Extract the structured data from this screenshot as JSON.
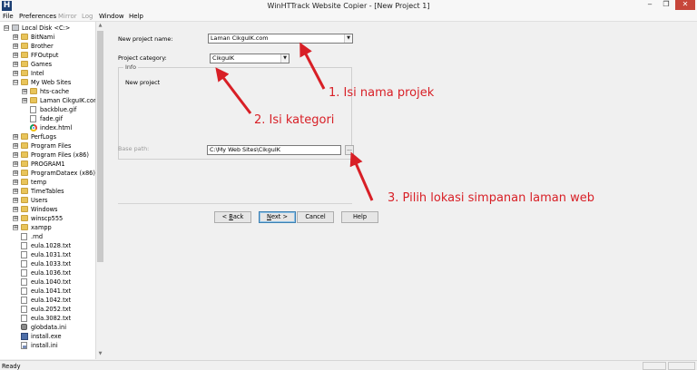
{
  "window": {
    "title": "WinHTTrack Website Copier - [New Project 1]",
    "app_icon_letter": "H",
    "min_glyph": "‒",
    "max_glyph": "❐",
    "close_glyph": "✕"
  },
  "menu": {
    "file": "File",
    "preferences": "Preferences",
    "mirror": "Mirror",
    "log": "Log",
    "window": "Window",
    "help": "Help"
  },
  "tree": {
    "items": [
      {
        "label": "Local Disk <C:>",
        "icon": "drive-icon",
        "expander": "⊟"
      },
      {
        "label": "BitNami",
        "icon": "folder-icon",
        "expander": "⊞"
      },
      {
        "label": "Brother",
        "icon": "folder-icon",
        "expander": "⊞"
      },
      {
        "label": "FFOutput",
        "icon": "folder-icon",
        "expander": "⊞"
      },
      {
        "label": "Games",
        "icon": "folder-icon",
        "expander": "⊞"
      },
      {
        "label": "Intel",
        "icon": "folder-icon",
        "expander": "⊞"
      },
      {
        "label": "My Web Sites",
        "icon": "folder-icon",
        "expander": "⊟"
      },
      {
        "label": "hts-cache",
        "icon": "folder-icon",
        "expander": "⊞"
      },
      {
        "label": "Laman CikguIK.com",
        "icon": "folder-icon",
        "expander": "⊞"
      },
      {
        "label": "backblue.gif",
        "icon": "file-icon",
        "expander": ""
      },
      {
        "label": "fade.gif",
        "icon": "file-icon",
        "expander": ""
      },
      {
        "label": "index.html",
        "icon": "chrome-icon",
        "expander": ""
      },
      {
        "label": "PerfLogs",
        "icon": "folder-icon",
        "expander": "⊞"
      },
      {
        "label": "Program Files",
        "icon": "folder-icon",
        "expander": "⊞"
      },
      {
        "label": "Program Files (x86)",
        "icon": "folder-icon",
        "expander": "⊞"
      },
      {
        "label": "PROGRAM1",
        "icon": "folder-icon",
        "expander": "⊞"
      },
      {
        "label": "ProgramDataex (x86)",
        "icon": "folder-icon",
        "expander": "⊞"
      },
      {
        "label": "temp",
        "icon": "folder-icon",
        "expander": "⊞"
      },
      {
        "label": "TimeTables",
        "icon": "folder-icon",
        "expander": "⊞"
      },
      {
        "label": "Users",
        "icon": "folder-icon",
        "expander": "⊞"
      },
      {
        "label": "Windows",
        "icon": "folder-icon",
        "expander": "⊞"
      },
      {
        "label": "winscp555",
        "icon": "folder-icon",
        "expander": "⊞"
      },
      {
        "label": "xampp",
        "icon": "folder-icon",
        "expander": "⊞"
      },
      {
        "label": ".rnd",
        "icon": "file-icon",
        "expander": ""
      },
      {
        "label": "eula.1028.txt",
        "icon": "file-icon",
        "expander": ""
      },
      {
        "label": "eula.1031.txt",
        "icon": "file-icon",
        "expander": ""
      },
      {
        "label": "eula.1033.txt",
        "icon": "file-icon",
        "expander": ""
      },
      {
        "label": "eula.1036.txt",
        "icon": "file-icon",
        "expander": ""
      },
      {
        "label": "eula.1040.txt",
        "icon": "file-icon",
        "expander": ""
      },
      {
        "label": "eula.1041.txt",
        "icon": "file-icon",
        "expander": ""
      },
      {
        "label": "eula.1042.txt",
        "icon": "file-icon",
        "expander": ""
      },
      {
        "label": "eula.2052.txt",
        "icon": "file-icon",
        "expander": ""
      },
      {
        "label": "eula.3082.txt",
        "icon": "file-icon",
        "expander": ""
      },
      {
        "label": "globdata.ini",
        "icon": "gear-icon",
        "expander": ""
      },
      {
        "label": "install.exe",
        "icon": "exe-icon",
        "expander": ""
      },
      {
        "label": "install.ini",
        "icon": "ini-icon",
        "expander": ""
      }
    ]
  },
  "form": {
    "project_name_label": "New project name:",
    "project_name_value": "Laman CikguIK.com",
    "project_category_label": "Project category:",
    "project_category_value": "CikguIK",
    "info_legend": "Info",
    "info_text": "New project",
    "base_path_label": "Base path:",
    "base_path_value": "C:\\My Web Sites\\CikguIK",
    "browse_label": "...",
    "dropdown_glyph": "▼"
  },
  "buttons": {
    "back": "< Back",
    "back_mnemonic": "B",
    "back_rest": "ack",
    "next": "Next >",
    "next_mnemonic": "N",
    "next_rest": "ext >",
    "cancel": "Cancel",
    "help": "Help"
  },
  "annotations": {
    "step1": "1. Isi nama projek",
    "step2": "2. Isi kategori",
    "step3": "3. Pilih lokasi simpanan laman web",
    "color": "#d81f26"
  },
  "status": {
    "text": "Ready"
  },
  "scroll": {
    "up_glyph": "▲",
    "down_glyph": "▼"
  }
}
